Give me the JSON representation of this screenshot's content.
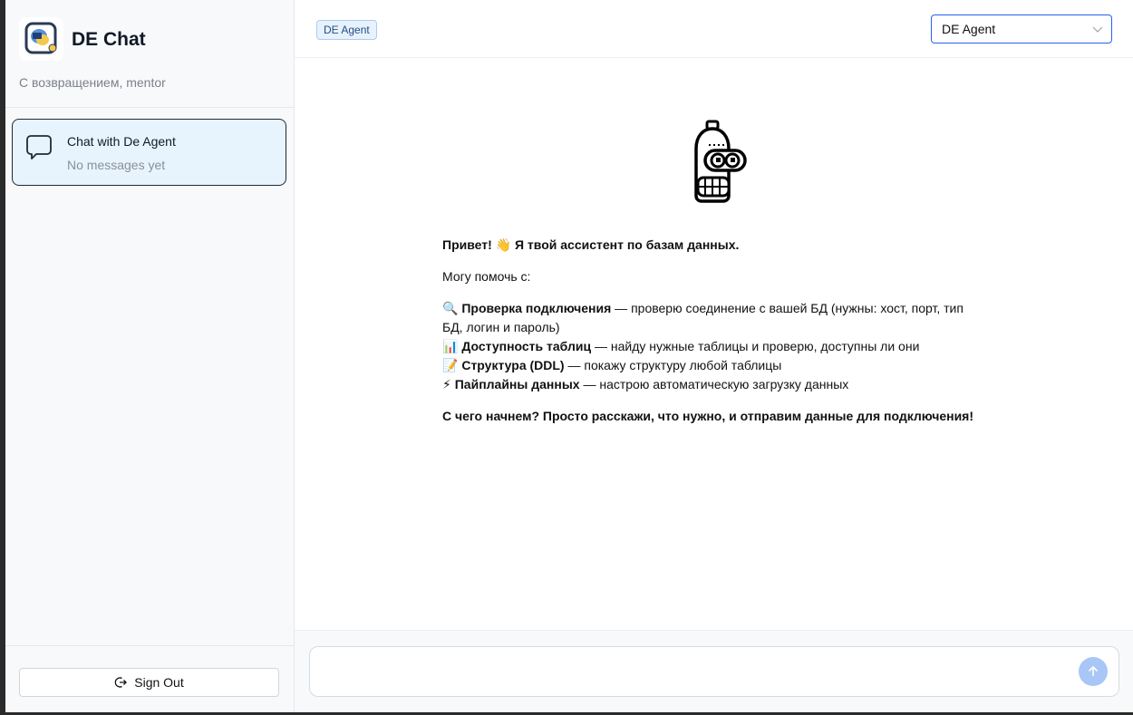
{
  "app": {
    "title": "DE Chat",
    "welcome": "С возвращением, mentor"
  },
  "sidebar": {
    "chats": [
      {
        "title": "Chat with De Agent",
        "subtitle": "No messages yet",
        "active": true
      }
    ],
    "signout_label": "Sign Out"
  },
  "header": {
    "agent_badge": "DE Agent",
    "agent_select": {
      "value": "DE Agent"
    }
  },
  "message": {
    "greeting": "Привет! 👋 Я твой ассистент по базам данных.",
    "intro": "Могу помочь с:",
    "items": [
      {
        "icon": "🔍",
        "title": "Проверка подключения",
        "text": " — проверю соединение с вашей БД (нужны: хост, порт, тип БД, логин и пароль)"
      },
      {
        "icon": "📊",
        "title": "Доступность таблиц",
        "text": " — найду нужные таблицы и проверю, доступны ли они"
      },
      {
        "icon": "📝",
        "title": "Структура (DDL)",
        "text": " — покажу структуру любой таблицы"
      },
      {
        "icon": "⚡",
        "title": "Пайплайны данных",
        "text": " — настрою автоматическую загрузку данных"
      }
    ],
    "closing": "С чего начнем? Просто расскажи, что нужно, и отправим данные для подключения!"
  },
  "composer": {
    "placeholder": ""
  },
  "colors": {
    "accent": "#2563eb",
    "active_chat_bg": "#e7f4fd",
    "send_button": "#a8c6f6"
  }
}
